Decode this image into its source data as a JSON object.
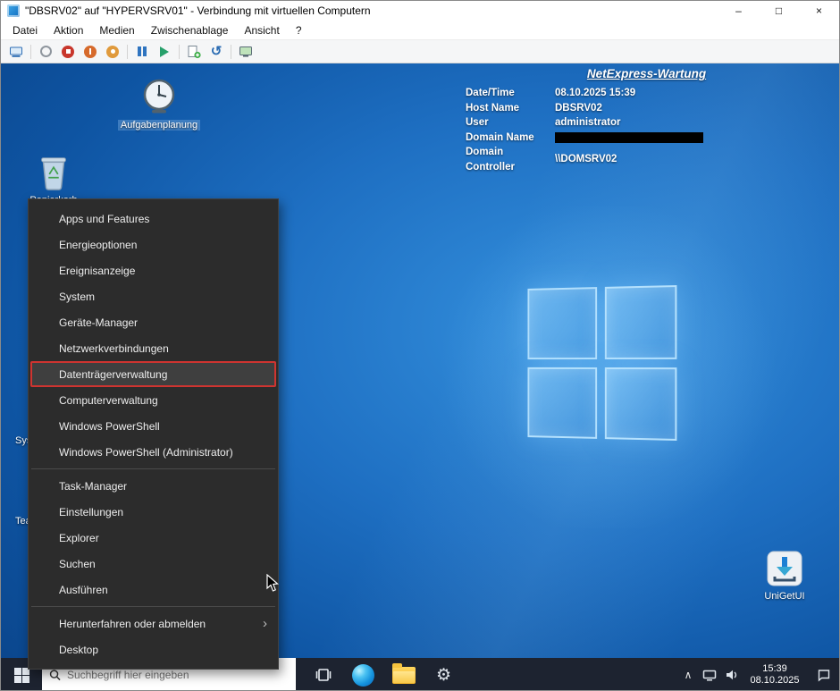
{
  "window": {
    "title": "\"DBSRV02\" auf \"HYPERVSRV01\" - Verbindung mit virtuellen Computern",
    "controls": {
      "minimize": "–",
      "maximize": "□",
      "close": "×"
    }
  },
  "menubar": {
    "items": [
      {
        "label": "Datei"
      },
      {
        "label": "Aktion"
      },
      {
        "label": "Medien"
      },
      {
        "label": "Zwischenablage"
      },
      {
        "label": "Ansicht"
      },
      {
        "label": "?"
      }
    ]
  },
  "toolbar": {
    "icons": [
      "ctrl-alt-del",
      "start",
      "turn-off",
      "shutdown",
      "save",
      "pause",
      "resume",
      "checkpoint",
      "revert",
      "enhanced-session"
    ]
  },
  "overlay": {
    "title": "NetExpress-Wartung",
    "rows": [
      {
        "label": "Date/Time",
        "value": "08.10.2025 15:39"
      },
      {
        "label": "Host Name",
        "value": "DBSRV02"
      },
      {
        "label": "User",
        "value": "administrator"
      },
      {
        "label": "Domain Name",
        "value": "",
        "redacted": true
      },
      {
        "label": "Domain Controller",
        "value": "\\\\DOMSRV02"
      }
    ]
  },
  "desktop": {
    "icons": [
      {
        "label": "Aufgabenplanung"
      },
      {
        "label": "Papierkorb"
      },
      {
        "label": "UniGetUI"
      }
    ],
    "partial_labels": [
      "Sys",
      "Tea"
    ]
  },
  "context_menu": {
    "items": [
      {
        "label": "Apps und Features"
      },
      {
        "label": "Energieoptionen"
      },
      {
        "label": "Ereignisanzeige"
      },
      {
        "label": "System"
      },
      {
        "label": "Geräte-Manager"
      },
      {
        "label": "Netzwerkverbindungen"
      },
      {
        "label": "Datenträgerverwaltung",
        "highlighted": true
      },
      {
        "label": "Computerverwaltung"
      },
      {
        "label": "Windows PowerShell"
      },
      {
        "label": "Windows PowerShell (Administrator)"
      },
      {
        "label": "Task-Manager"
      },
      {
        "label": "Einstellungen"
      },
      {
        "label": "Explorer"
      },
      {
        "label": "Suchen"
      },
      {
        "label": "Ausführen"
      },
      {
        "label": "Herunterfahren oder abmelden",
        "submenu": true
      },
      {
        "label": "Desktop"
      }
    ],
    "submenu_chevron": "›"
  },
  "taskbar": {
    "search_placeholder": "Suchbegriff hier eingeben",
    "tray": {
      "chevron": "∧",
      "time": "15:39",
      "date": "08.10.2025"
    }
  },
  "glyphs": {
    "gear": "⚙",
    "revert": "↺"
  },
  "colors": {
    "annotation_red": "#cf3430",
    "desktop_blue": "#1e6fc2",
    "taskbar_dark": "#1d2330"
  }
}
